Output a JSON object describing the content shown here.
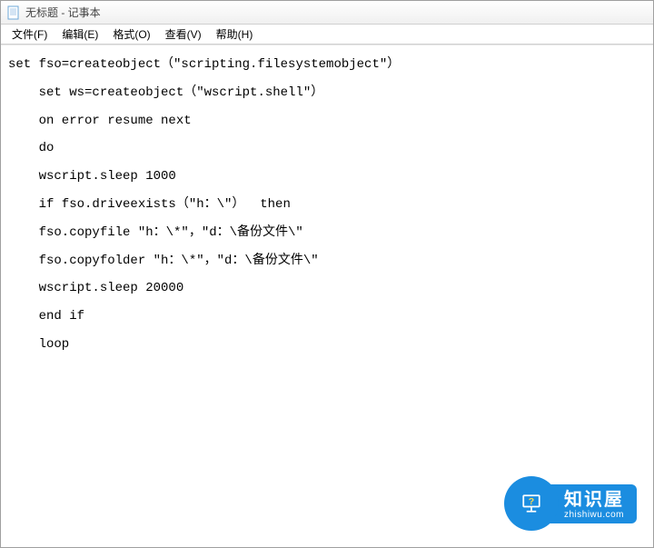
{
  "window": {
    "title": "无标题 - 记事本"
  },
  "menu": {
    "file": "文件(F)",
    "edit": "编辑(E)",
    "format": "格式(O)",
    "view": "查看(V)",
    "help": "帮助(H)"
  },
  "editor": {
    "content": "set fso=createobject（\"scripting.filesystemobject\"）\n    set ws=createobject（\"wscript.shell\"）\n    on error resume next\n    do\n    wscript.sleep 1000\n    if fso.driveexists（\"h：\\\"）  then\n    fso.copyfile \"h：\\*\"，\"d：\\备份文件\\\"\n    fso.copyfolder \"h：\\*\"，\"d：\\备份文件\\\"\n    wscript.sleep 20000\n    end if\n    loop"
  },
  "watermark": {
    "title": "知识屋",
    "subtitle": "zhishiwu.com"
  }
}
